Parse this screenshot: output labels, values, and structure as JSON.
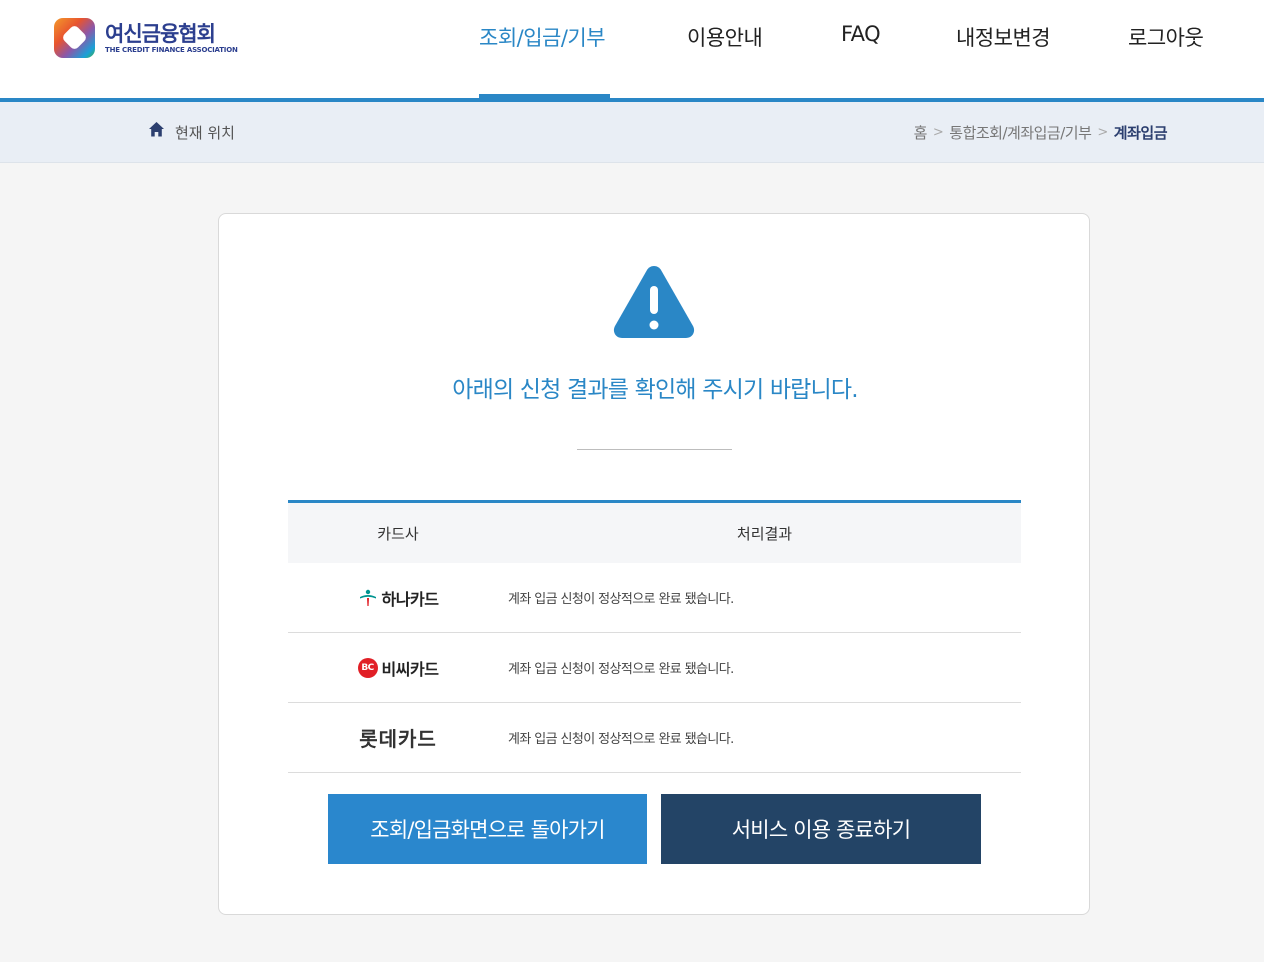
{
  "logo": {
    "name_ko": "여신금융협회",
    "name_en": "THE CREDIT FINANCE ASSOCIATION"
  },
  "nav": {
    "items": [
      {
        "label": "조회/입금/기부",
        "active": true
      },
      {
        "label": "이용안내",
        "active": false
      },
      {
        "label": "FAQ",
        "active": false
      },
      {
        "label": "내정보변경",
        "active": false
      },
      {
        "label": "로그아웃",
        "active": false
      }
    ]
  },
  "breadcrumb": {
    "location_label": "현재 위치",
    "path": [
      "홈",
      "통합조회/계좌입금/기부",
      "계좌입금"
    ],
    "separator": ">"
  },
  "result": {
    "message": "아래의 신청 결과를 확인해 주시기 바랍니다.",
    "table": {
      "headers": [
        "카드사",
        "처리결과"
      ],
      "rows": [
        {
          "card": "하나카드",
          "status": "계좌 입금 신청이 정상적으로 완료 됐습니다."
        },
        {
          "card": "비씨카드",
          "status": "계좌 입금 신청이 정상적으로 완료 됐습니다."
        },
        {
          "card": "롯데카드",
          "status": "계좌 입금 신청이 정상적으로 완료 됐습니다."
        }
      ]
    },
    "bc_badge_text": "BC"
  },
  "buttons": {
    "back_label": "조회/입금화면으로 돌아가기",
    "end_label": "서비스 이용 종료하기"
  },
  "colors": {
    "accent": "#2a87c6",
    "primary_button": "#2a87cd",
    "dark_button": "#234466",
    "breadcrumb_bg": "#e9eef5",
    "hana_green": "#009490",
    "bc_red": "#e11f26"
  },
  "icons": {
    "home": "home-icon",
    "warning": "warning-triangle-icon",
    "hana": "hana-card-logo-icon",
    "bc": "bc-card-logo-icon"
  }
}
